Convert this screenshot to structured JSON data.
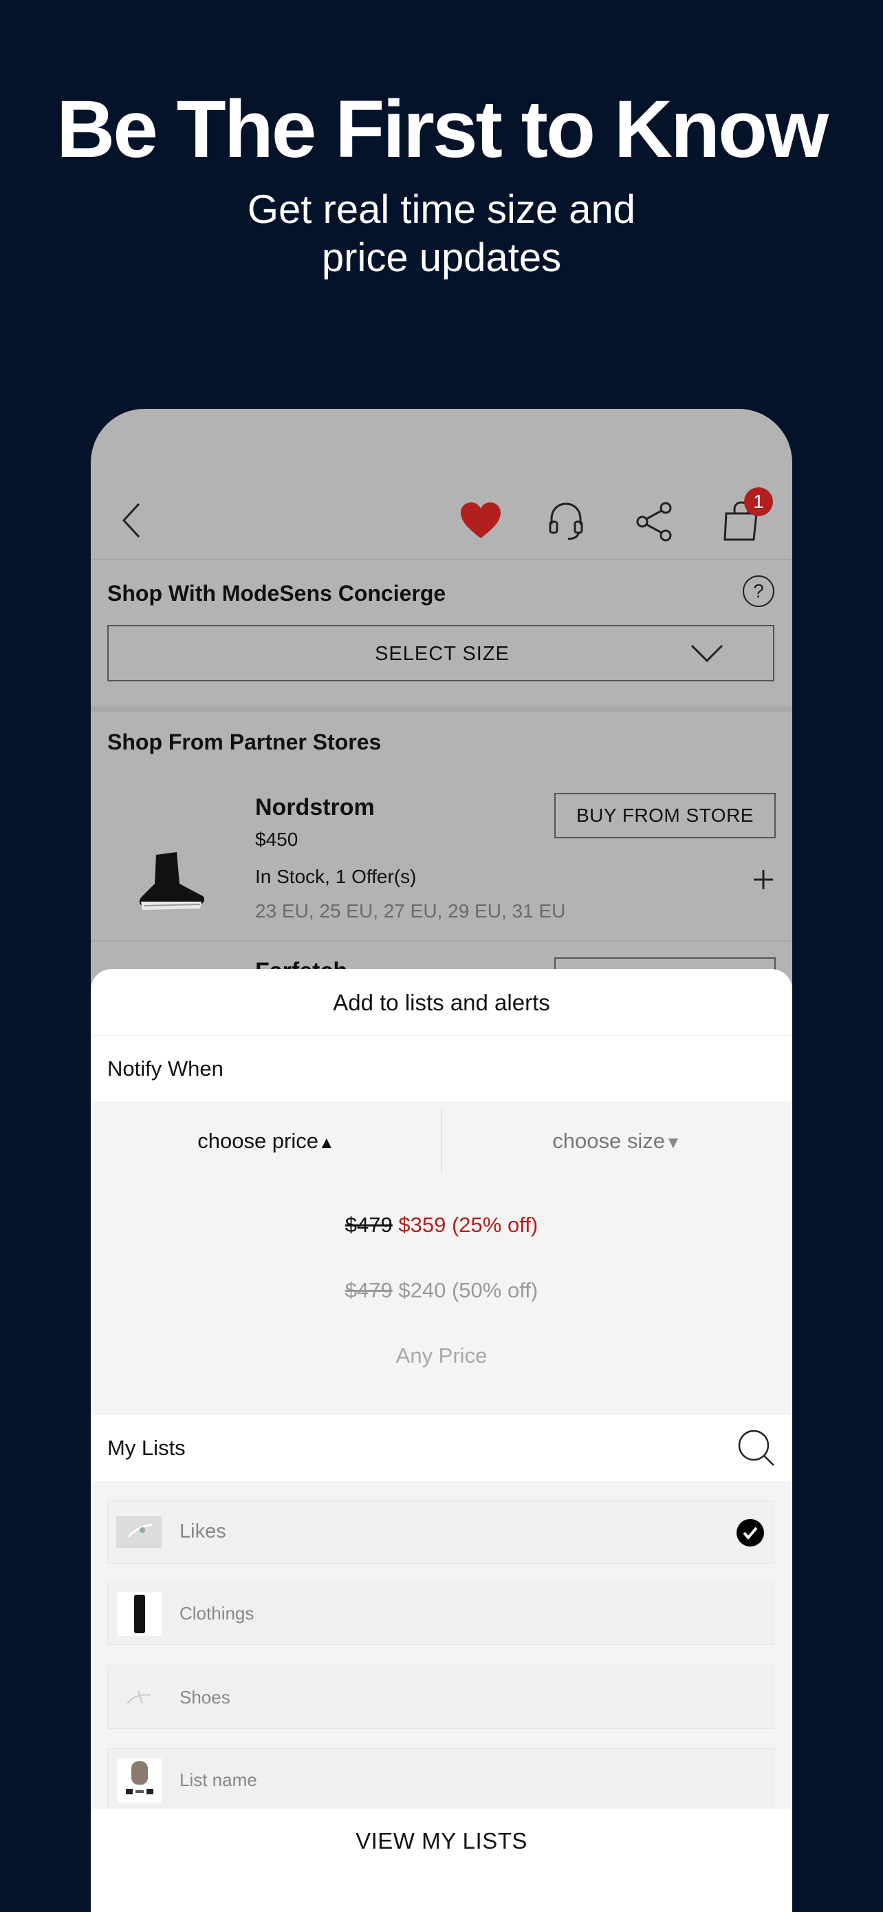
{
  "hero": {
    "title": "Be The First to Know",
    "subtitle_line1": "Get real time size and",
    "subtitle_line2": "price updates"
  },
  "toolbar": {
    "back_icon": "chevron-left-icon",
    "favorite_icon": "heart-icon",
    "support_icon": "headset-icon",
    "share_icon": "share-icon",
    "bag_icon": "shopping-bag-icon",
    "bag_count": "1",
    "favorite_color": "#b21f1f"
  },
  "concierge": {
    "title": "Shop With ModeSens Concierge",
    "help_glyph": "?",
    "select_size_label": "SELECT SIZE"
  },
  "partner": {
    "title": "Shop From Partner Stores",
    "stores": [
      {
        "name": "Nordstrom",
        "price": "$450",
        "stock": "In Stock, 1 Offer(s)",
        "sizes": "23 EU, 25 EU, 27 EU, 29 EU, 31 EU",
        "button": "BUY FROM STORE"
      },
      {
        "name": "Farfetch"
      }
    ]
  },
  "sheet": {
    "title": "Add to lists and alerts",
    "notify_label": "Notify When",
    "choose_price": "choose price",
    "choose_size": "choose size",
    "price_options": [
      {
        "original": "$479",
        "sale": "$359 (25% off)"
      },
      {
        "original": "$479",
        "sale": "$240 (50% off)"
      }
    ],
    "any_price": "Any Price",
    "my_lists_label": "My Lists",
    "lists": [
      {
        "name": "Likes",
        "checked": true
      },
      {
        "name": "Clothings",
        "checked": false
      },
      {
        "name": "Shoes",
        "checked": false
      },
      {
        "name": "List name",
        "checked": false
      }
    ],
    "view_my_lists": "VIEW MY LISTS",
    "sale_color": "#b21f1f"
  }
}
